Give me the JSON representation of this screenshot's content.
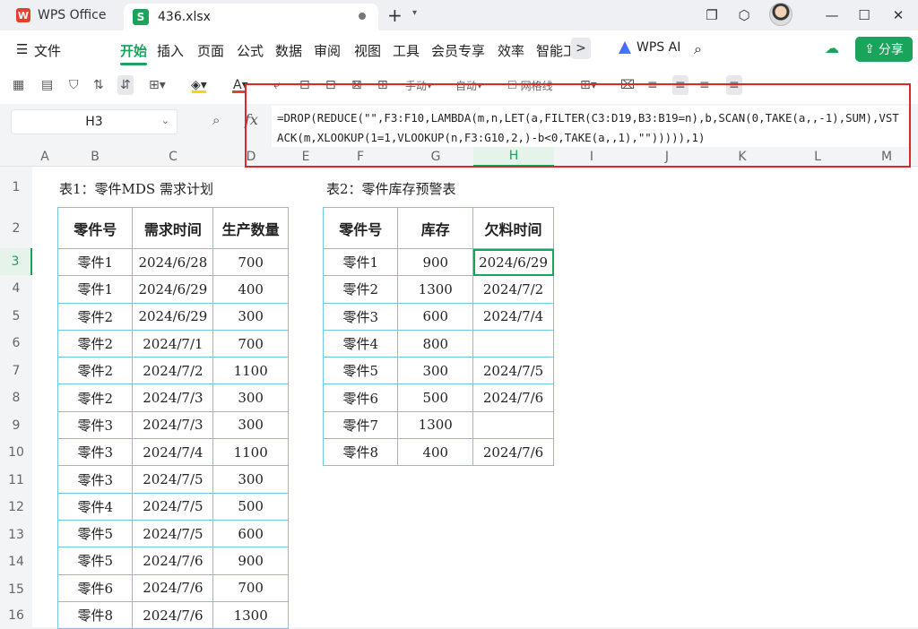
{
  "titlebar": {
    "app_name": "WPS Office",
    "app_logo_letter": "W",
    "file_logo_letter": "S",
    "file_tab": "436.xlsx",
    "new_tab": "+"
  },
  "menu": {
    "file": "文件",
    "items": [
      "开始",
      "插入",
      "页面",
      "公式",
      "数据",
      "审阅",
      "视图",
      "工具",
      "会员专享",
      "效率",
      "智能工"
    ],
    "more": ">",
    "wps_ai": "WPS AI",
    "share": "分享"
  },
  "toolbar": {
    "manual": "手动",
    "auto": "自动",
    "gridlines": "网格线",
    "more": "···"
  },
  "formula_bar": {
    "name_box": "H3",
    "fx": "fx",
    "formula": "=DROP(REDUCE(\"\",F3:F10,LAMBDA(m,n,LET(a,FILTER(C3:D19,B3:B19=n),b,SCAN(0,TAKE(a,,-1),SUM),VSTACK(m,XLOOKUP(1=1,VLOOKUP(n,F3:G10,2,)-b<0,TAKE(a,,1),\"\"))))),1)"
  },
  "columns": [
    "A",
    "B",
    "C",
    "D",
    "E",
    "F",
    "G",
    "H",
    "I",
    "J",
    "K",
    "L",
    "M"
  ],
  "rows": [
    "1",
    "2",
    "3",
    "4",
    "5",
    "6",
    "7",
    "8",
    "9",
    "10",
    "11",
    "12",
    "13",
    "14",
    "15",
    "16"
  ],
  "table1": {
    "caption": "表1：零件MDS 需求计划",
    "headers": [
      "零件号",
      "需求时间",
      "生产数量"
    ],
    "rows": [
      [
        "零件1",
        "2024/6/28",
        "700"
      ],
      [
        "零件1",
        "2024/6/29",
        "400"
      ],
      [
        "零件2",
        "2024/6/29",
        "300"
      ],
      [
        "零件2",
        "2024/7/1",
        "700"
      ],
      [
        "零件2",
        "2024/7/2",
        "1100"
      ],
      [
        "零件2",
        "2024/7/3",
        "300"
      ],
      [
        "零件3",
        "2024/7/3",
        "300"
      ],
      [
        "零件3",
        "2024/7/4",
        "1100"
      ],
      [
        "零件3",
        "2024/7/5",
        "300"
      ],
      [
        "零件4",
        "2024/7/5",
        "500"
      ],
      [
        "零件5",
        "2024/7/5",
        "600"
      ],
      [
        "零件5",
        "2024/7/6",
        "900"
      ],
      [
        "零件6",
        "2024/7/6",
        "700"
      ],
      [
        "零件8",
        "2024/7/6",
        "1300"
      ]
    ]
  },
  "table2": {
    "caption": "表2：零件库存预警表",
    "headers": [
      "零件号",
      "库存",
      "欠料时间"
    ],
    "rows": [
      [
        "零件1",
        "900",
        "2024/6/29"
      ],
      [
        "零件2",
        "1300",
        "2024/7/2"
      ],
      [
        "零件3",
        "600",
        "2024/7/4"
      ],
      [
        "零件4",
        "800",
        ""
      ],
      [
        "零件5",
        "300",
        "2024/7/5"
      ],
      [
        "零件6",
        "500",
        "2024/7/6"
      ],
      [
        "零件7",
        "1300",
        ""
      ],
      [
        "零件8",
        "400",
        "2024/7/6"
      ]
    ]
  },
  "colors": {
    "accent": "#19a35b",
    "highlight_box": "#e0262b",
    "table_border": "#6ccbe0"
  }
}
